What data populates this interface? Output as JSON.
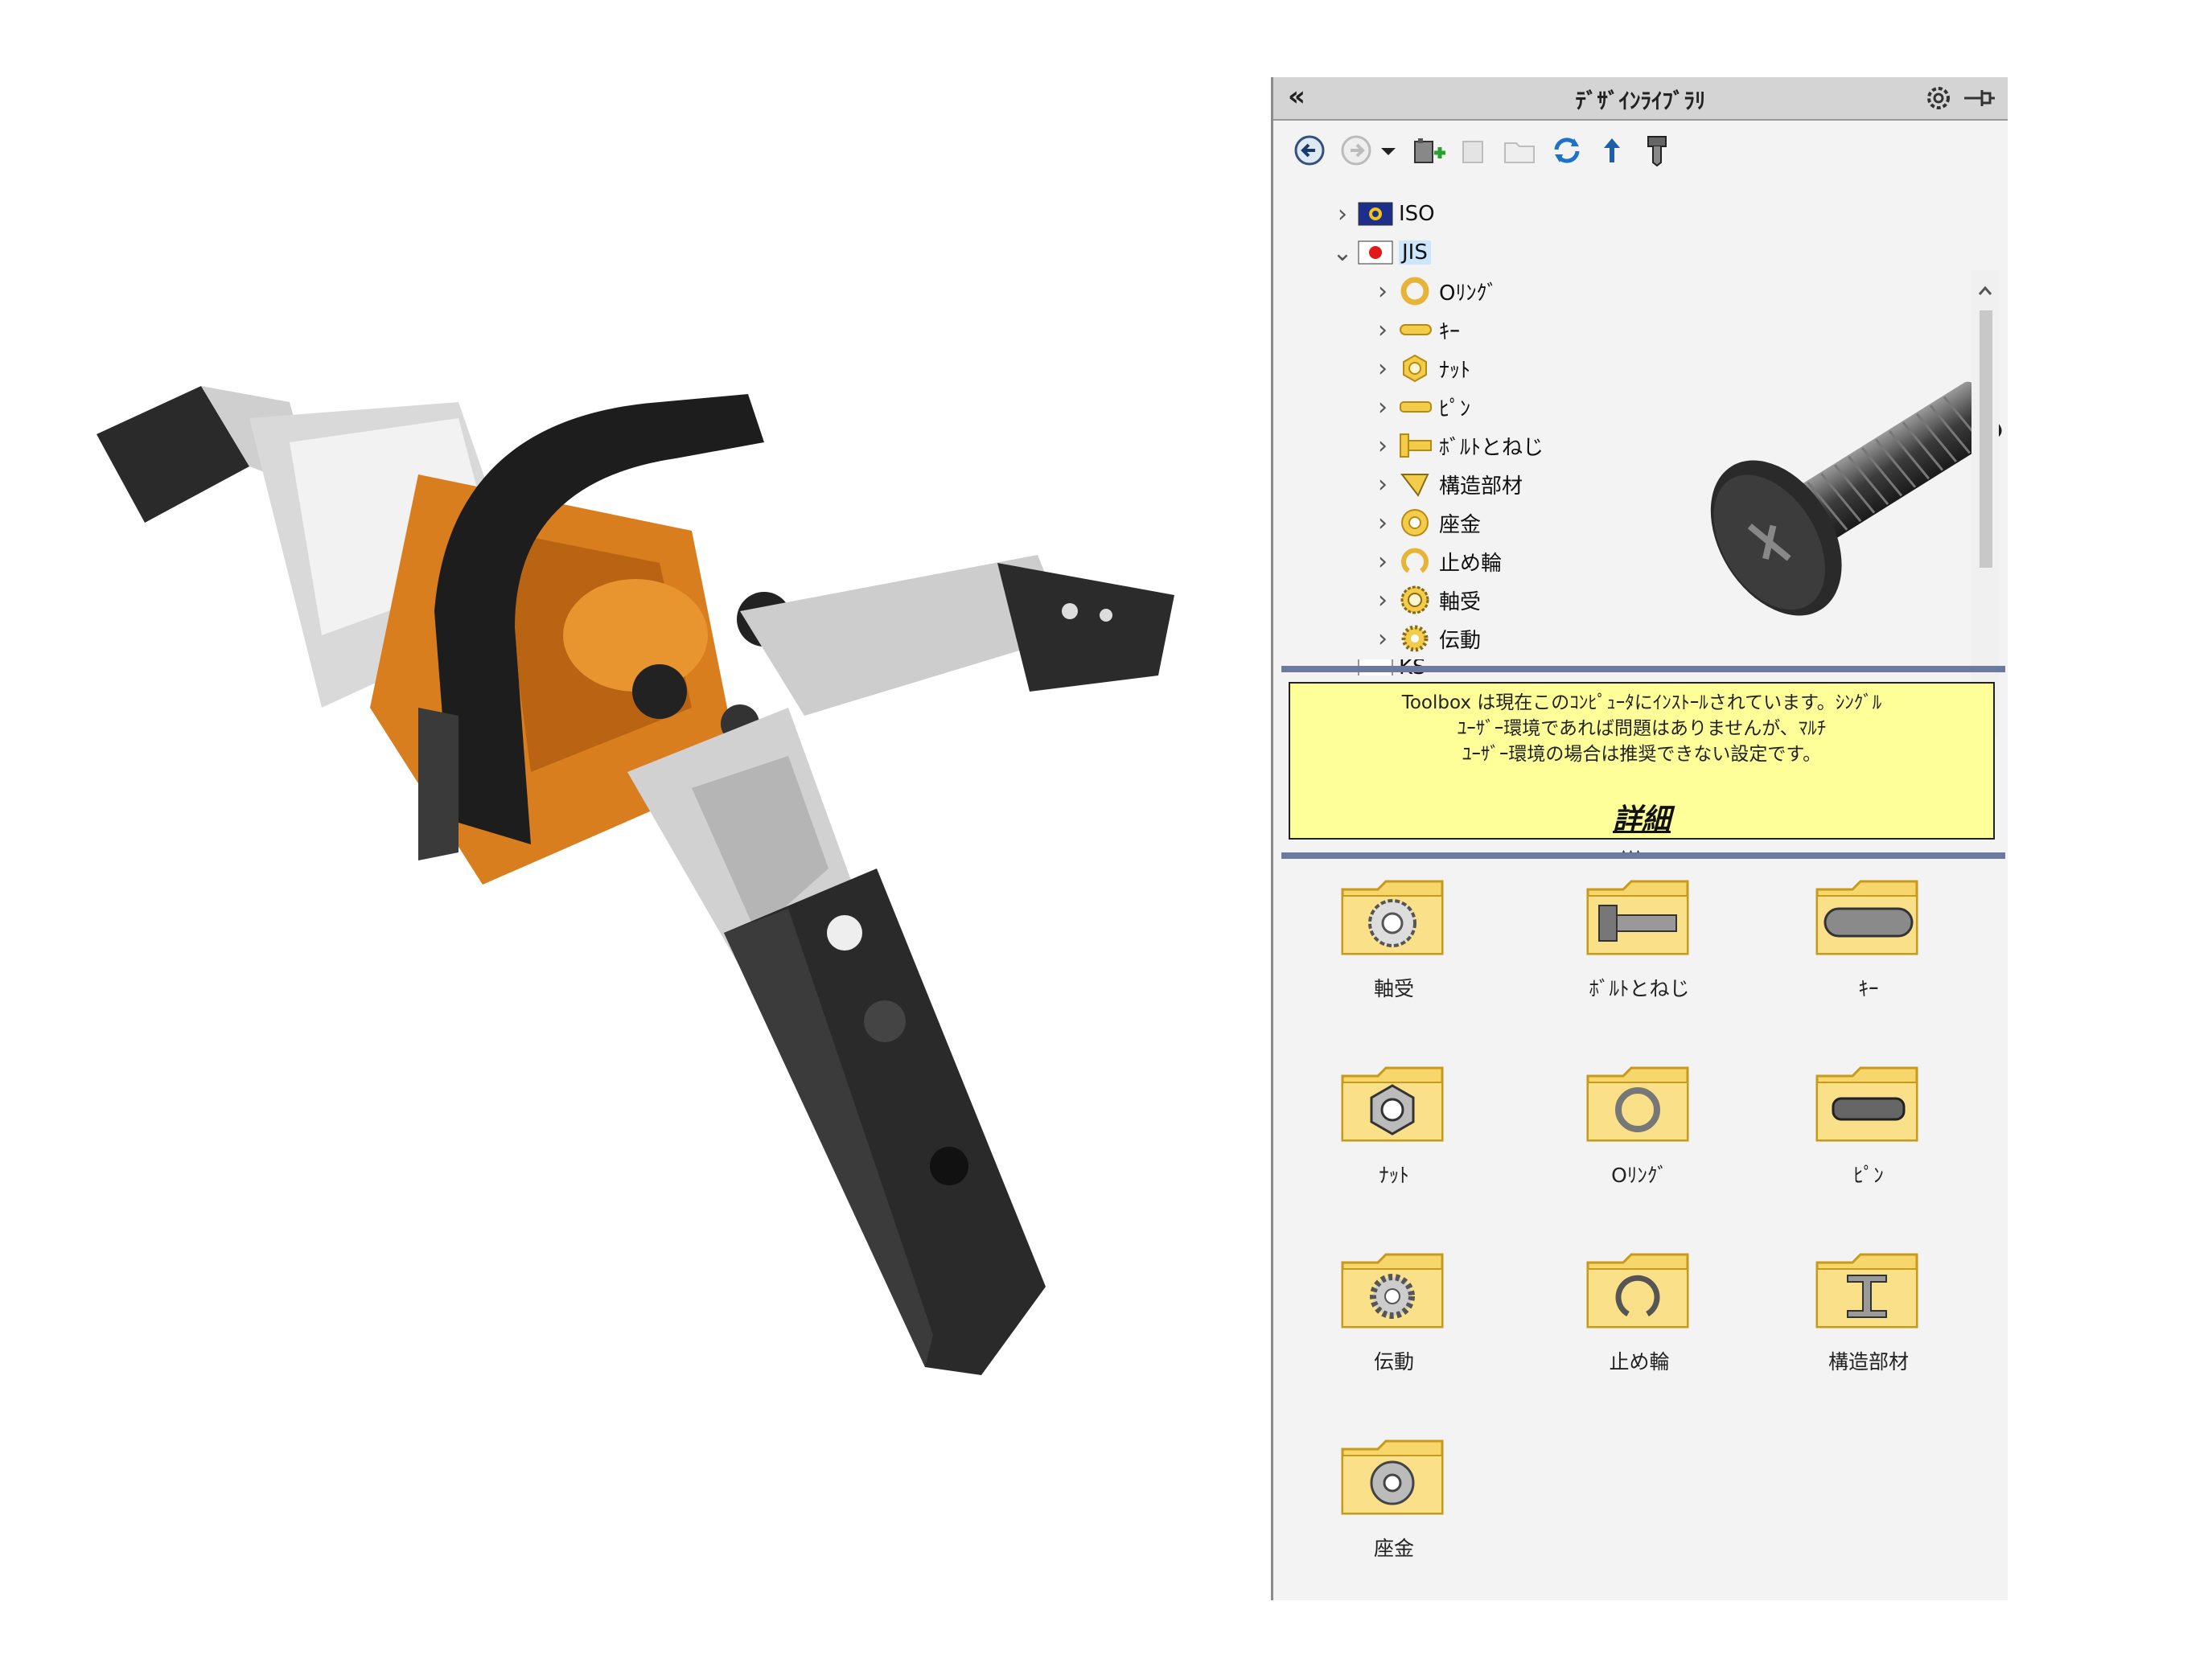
{
  "design_library": {
    "title": "ﾃﾞｻﾞｲﾝﾗｲﾌﾞﾗﾘ",
    "collapse_glyph": "«",
    "toolbar_icons": [
      "back-icon",
      "forward-icon",
      "dropdown-icon",
      "add-library-icon",
      "create-folder-icon",
      "open-folder-icon",
      "refresh-icon",
      "up-icon",
      "toolbox-icon"
    ],
    "tree": {
      "standards": [
        {
          "label": "ISO",
          "expanded": false
        },
        {
          "label": "JIS",
          "expanded": true
        }
      ],
      "jis_children": [
        "Oﾘﾝｸﾞ",
        "ｷｰ",
        "ﾅｯﾄ",
        "ﾋﾟﾝ",
        "ﾎﾞﾙﾄとねじ",
        "構造部材",
        "座金",
        "止め輪",
        "軸受",
        "伝動"
      ],
      "partial_next": "KS"
    },
    "notice": {
      "line1": "Toolbox は現在このｺﾝﾋﾟｭｰﾀにｲﾝｽﾄｰﾙされています。ｼﾝｸﾞﾙ",
      "line2": "ﾕｰｻﾞｰ環境であれば問題はありませんが、ﾏﾙﾁ",
      "line3": "ﾕｰｻﾞｰ環境の場合は推奨できない設定です。",
      "details": "詳細"
    },
    "folders": [
      {
        "label": "軸受",
        "icon": "bearing-icon"
      },
      {
        "label": "ﾎﾞﾙﾄとねじ",
        "icon": "bolt-icon"
      },
      {
        "label": "ｷｰ",
        "icon": "key-icon"
      },
      {
        "label": "ﾅｯﾄ",
        "icon": "nut-icon"
      },
      {
        "label": "Oﾘﾝｸﾞ",
        "icon": "o-ring-icon"
      },
      {
        "label": "ﾋﾟﾝ",
        "icon": "pin-icon"
      },
      {
        "label": "伝動",
        "icon": "gear-icon"
      },
      {
        "label": "止め輪",
        "icon": "retaining-ring-icon"
      },
      {
        "label": "構造部材",
        "icon": "beam-icon"
      },
      {
        "label": "座金",
        "icon": "washer-icon"
      }
    ]
  },
  "colors": {
    "orange": "#d97e1f",
    "folder": "#f7d66b",
    "notice_bg": "#ffff99",
    "selection": "#cde6fb"
  }
}
